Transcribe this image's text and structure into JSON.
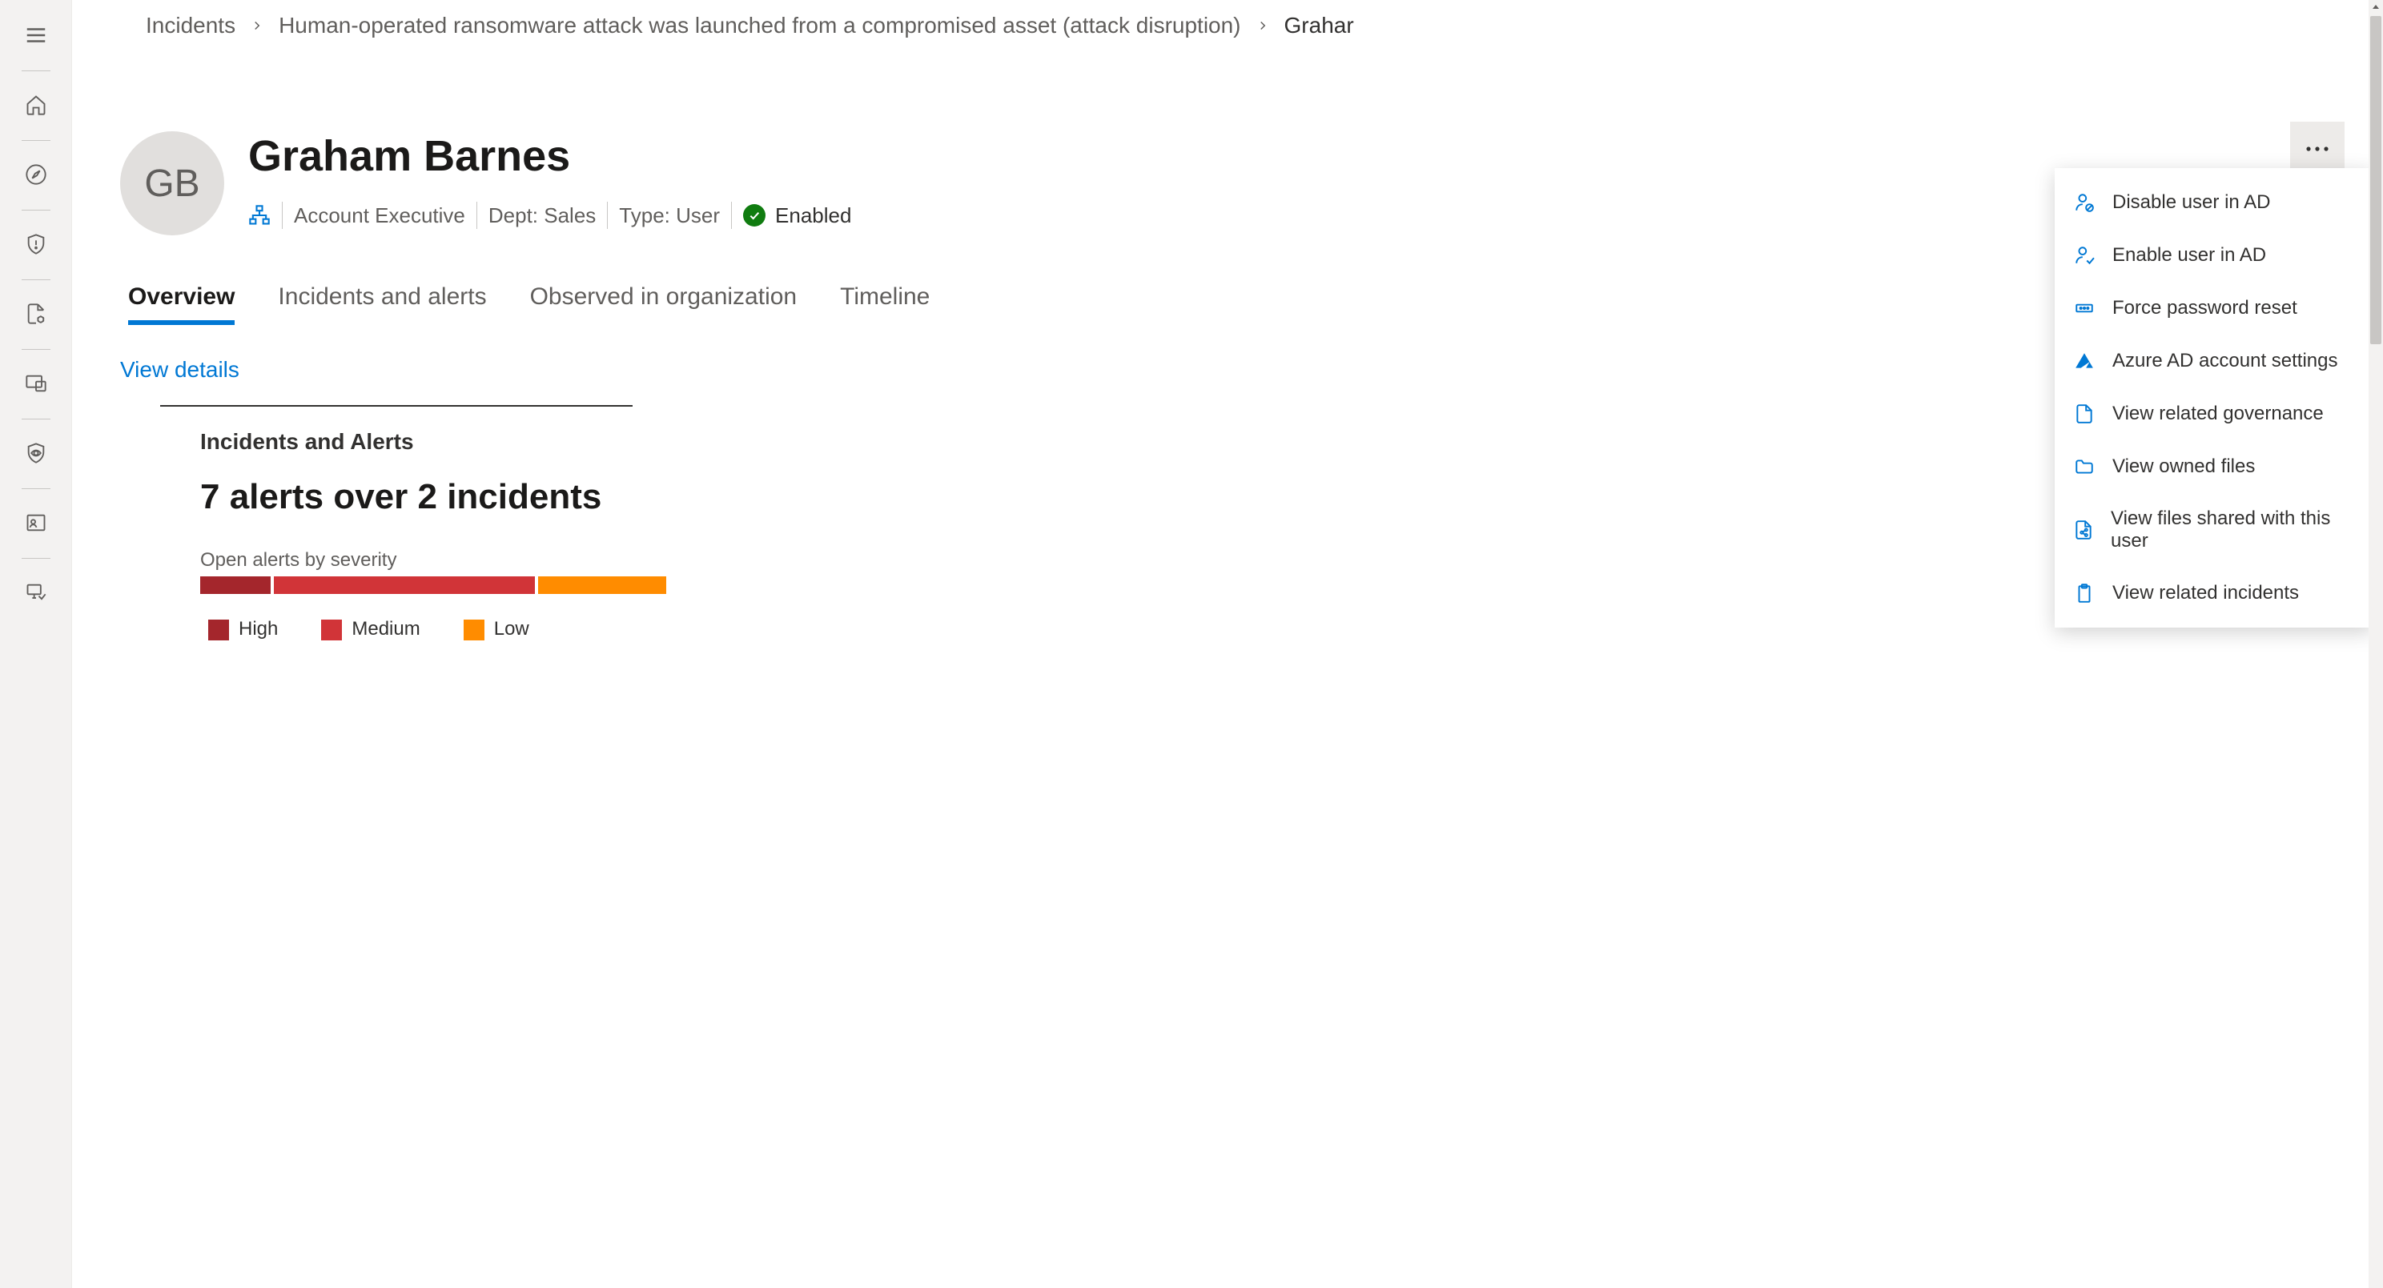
{
  "breadcrumb": {
    "items": [
      "Incidents",
      "Human-operated ransomware attack was launched from a compromised asset (attack disruption)",
      "Grahar"
    ]
  },
  "user": {
    "initials": "GB",
    "name": "Graham Barnes",
    "role": "Account Executive",
    "dept_label": "Dept: Sales",
    "type_label": "Type: User",
    "status": "Enabled"
  },
  "tabs": {
    "overview": "Overview",
    "incidents": "Incidents and alerts",
    "observed": "Observed in organization",
    "timeline": "Timeline"
  },
  "overview": {
    "view_details": "View details",
    "panel_title": "Incidents and Alerts",
    "big_stat": "7 alerts over 2 incidents",
    "severity_label": "Open alerts by severity",
    "legend": {
      "high": "High",
      "medium": "Medium",
      "low": "Low"
    }
  },
  "menu": {
    "disable_ad": "Disable user in AD",
    "enable_ad": "Enable user in AD",
    "force_reset": "Force password reset",
    "azure_settings": "Azure AD account settings",
    "view_governance": "View related governance",
    "view_owned": "View owned files",
    "view_shared": "View files shared with this user",
    "view_incidents": "View related incidents"
  },
  "chart_data": {
    "type": "bar",
    "title": "Open alerts by severity",
    "categories": [
      "High",
      "Medium",
      "Low"
    ],
    "values": [
      1,
      4,
      2
    ],
    "colors": {
      "High": "#a4262c",
      "Medium": "#d13438",
      "Low": "#ff8c00"
    },
    "total_alerts": 7,
    "total_incidents": 2
  }
}
